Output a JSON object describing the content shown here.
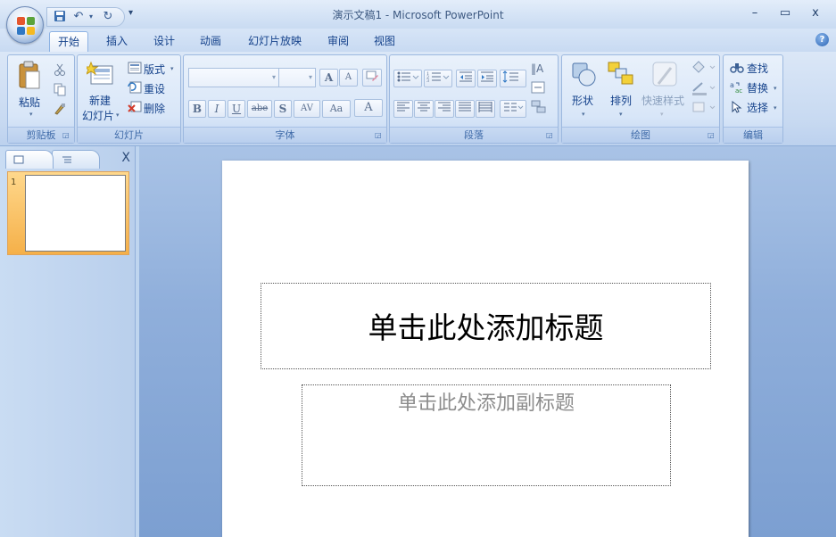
{
  "window": {
    "title": "演示文稿1 - Microsoft PowerPoint",
    "minimize": "–",
    "maximize": "▭",
    "close": "x",
    "qat_more": "▾"
  },
  "tabs": [
    "开始",
    "插入",
    "设计",
    "动画",
    "幻灯片放映",
    "审阅",
    "视图"
  ],
  "help": "?",
  "ribbon": {
    "clipboard": {
      "label": "剪贴板",
      "paste": "粘贴"
    },
    "slides": {
      "label": "幻灯片",
      "new_slide_line1": "新建",
      "new_slide_line2": "幻灯片",
      "layout": "版式",
      "reset": "重设",
      "delete": "删除"
    },
    "font": {
      "label": "字体",
      "bold": "B",
      "italic": "I",
      "underline": "U",
      "strike": "abe",
      "shadow": "S",
      "spacing": "AV",
      "case": "Aa",
      "color": "A",
      "grow": "A",
      "shrink": "A"
    },
    "paragraph": {
      "label": "段落"
    },
    "drawing": {
      "label": "绘图",
      "shapes": "形状",
      "arrange": "排列",
      "quick_styles": "快速样式"
    },
    "editing": {
      "label": "编辑",
      "find": "查找",
      "replace": "替换",
      "select": "选择"
    }
  },
  "panel": {
    "slide_number": "1",
    "close": "X"
  },
  "slide": {
    "title_placeholder": "单击此处添加标题",
    "subtitle_placeholder": "单击此处添加副标题"
  },
  "colors": {
    "accent": "#15428b",
    "selected_slide": "#f5b049"
  }
}
